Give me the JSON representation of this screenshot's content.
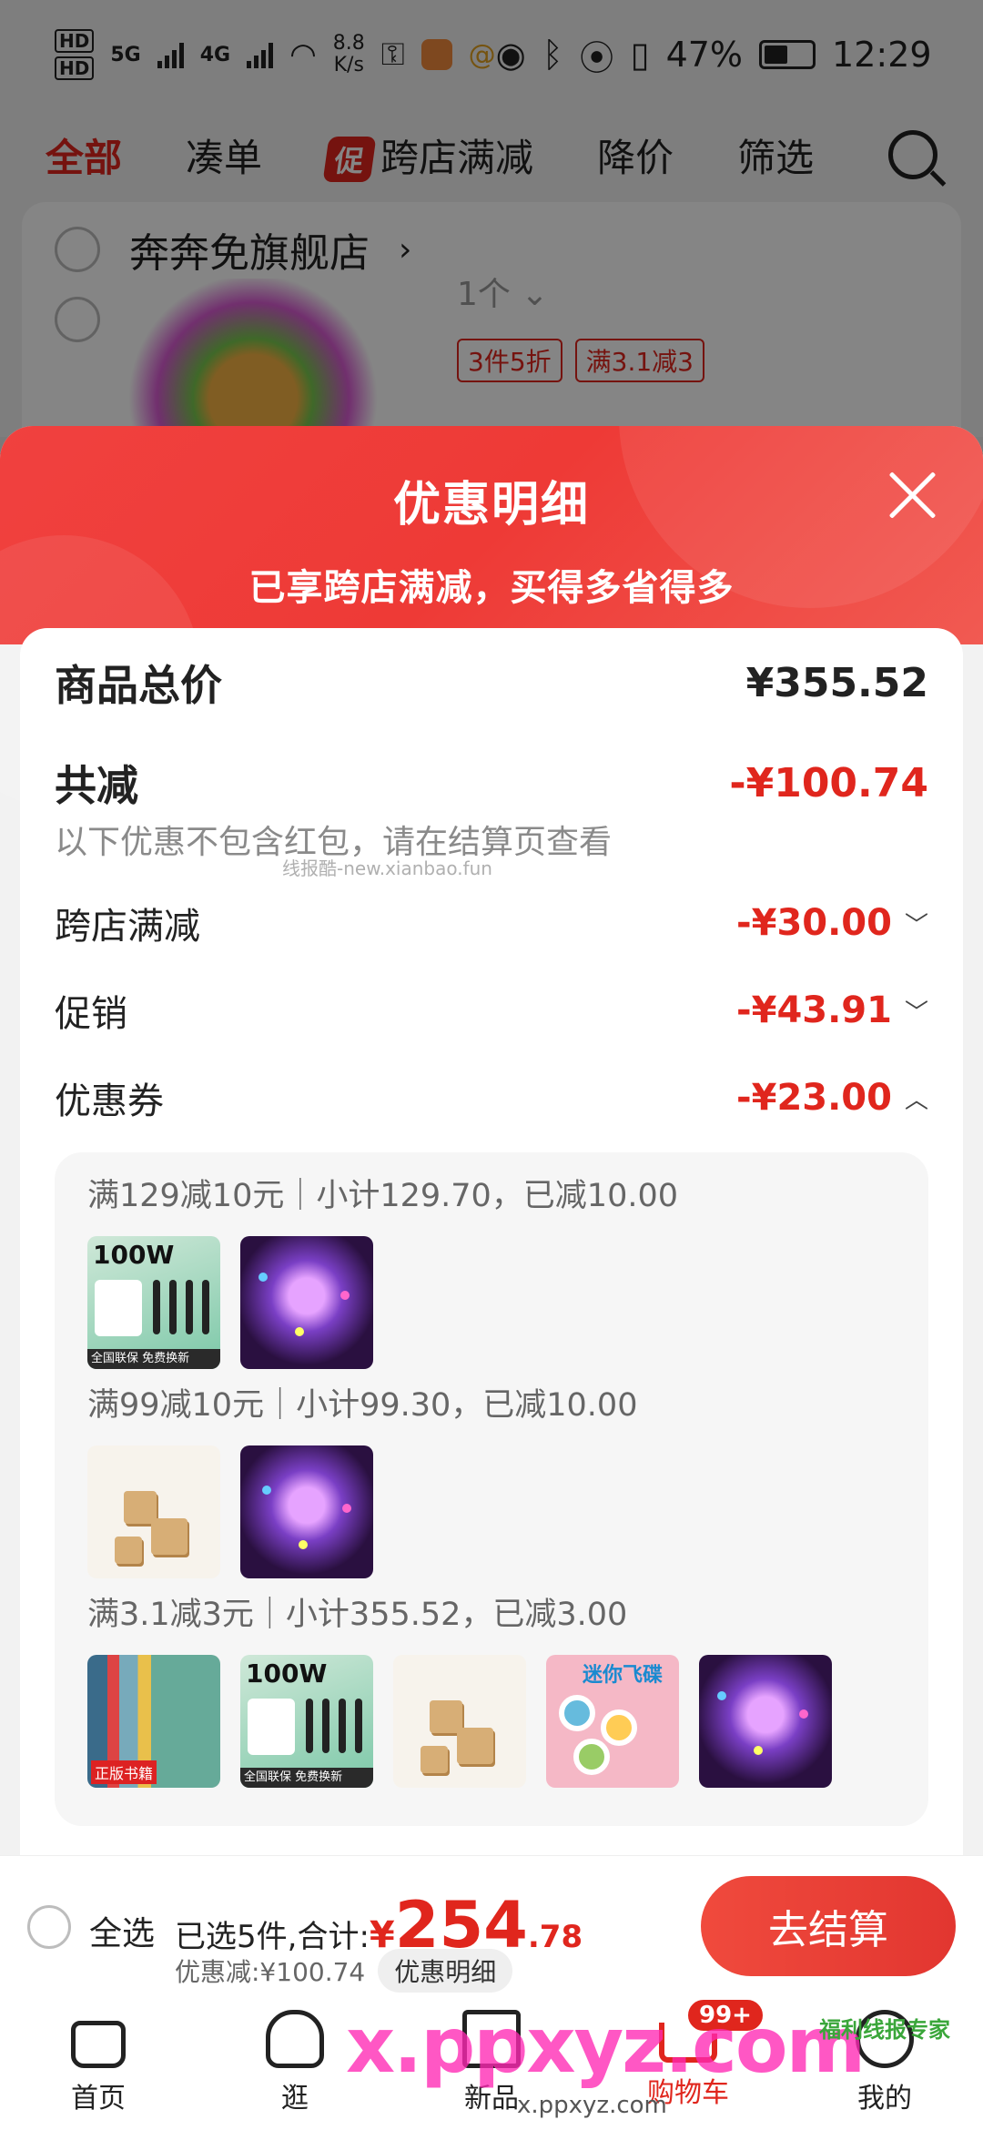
{
  "status_bar": {
    "hd1": "HD",
    "hd2": "HD",
    "net1": "5G",
    "net2": "4G",
    "speed_value": "8.8",
    "speed_unit": "K/s",
    "battery": "47%",
    "time": "12:29"
  },
  "top_nav": {
    "items": [
      "全部",
      "凑单",
      "跨店满减",
      "降价",
      "筛选"
    ],
    "promo_tag": "促"
  },
  "store": {
    "name": "奔奔免旗舰店",
    "qty": "1个",
    "tags": [
      "3件5折",
      "满3.1减3"
    ]
  },
  "sheet": {
    "title": "优惠明细",
    "subtitle": "已享跨店满减，买得多省得多",
    "total_label": "商品总价",
    "total_value": "¥355.52",
    "saved_label": "共减",
    "saved_value": "-¥100.74",
    "note": "以下优惠不包含红包，请在结算页查看",
    "watermark": "线报酷-new.xianbao.fun",
    "items": [
      {
        "label": "跨店满减",
        "value": "-¥30.00"
      },
      {
        "label": "促销",
        "value": "-¥43.91"
      },
      {
        "label": "优惠券",
        "value": "-¥23.00"
      }
    ],
    "coupons": [
      {
        "head": "满129减10元｜小计129.70，已减10.00",
        "thumbs": [
          "charger",
          "wings"
        ]
      },
      {
        "head": "满99减10元｜小计99.30，已减10.00",
        "thumbs": [
          "puzzle",
          "wings"
        ]
      },
      {
        "head": "满3.1减3元｜小计355.52，已减3.00",
        "thumbs": [
          "books",
          "charger",
          "puzzle",
          "spinner",
          "wings"
        ]
      }
    ],
    "thumb_text": {
      "charger_title": "100W",
      "charger_bar": "全国联保 免费换新",
      "books_tag": "正版书籍",
      "spinner_title": "迷你飞碟"
    }
  },
  "checkout": {
    "select_all": "全选",
    "selected_prefix": "已选5件,合计:",
    "yen": "¥",
    "amount_int": "254",
    "amount_dec": ".78",
    "discount_text": "优惠减:¥100.74",
    "detail_button": "优惠明细",
    "pay_button": "去结算"
  },
  "tab_bar": {
    "tabs": [
      "首页",
      "逛",
      "新品",
      "购物车",
      "我的"
    ],
    "cart_badge": "99+"
  },
  "watermarks": {
    "big": "x.ppxyz.com",
    "small": "x.ppxyz.com",
    "logo": "福利线报专家"
  },
  "colors": {
    "accent": "#e0261d",
    "header_gradient_start": "#f0413f"
  }
}
